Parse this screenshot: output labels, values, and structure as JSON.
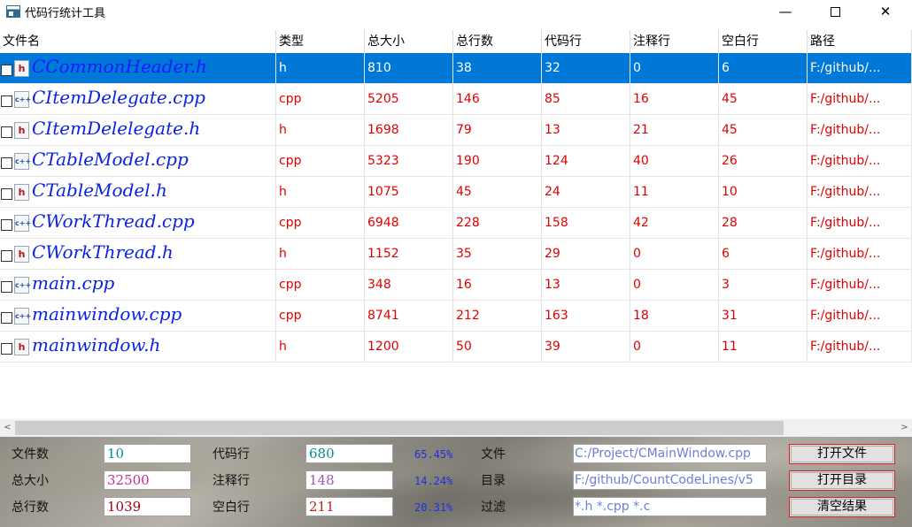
{
  "window": {
    "title": "代码行统计工具",
    "minimize_glyph": "—",
    "close_glyph": "✕"
  },
  "table": {
    "columns": [
      "文件名",
      "类型",
      "总大小",
      "总行数",
      "代码行",
      "注释行",
      "空白行",
      "路径"
    ],
    "rows": [
      {
        "name": "CCommonHeader.h",
        "type": "h",
        "size": "810",
        "total": "38",
        "code": "32",
        "comment": "0",
        "blank": "6",
        "path": "F:/github/...",
        "icon": "h-file-icon",
        "selected": true
      },
      {
        "name": "CItemDelegate.cpp",
        "type": "cpp",
        "size": "5205",
        "total": "146",
        "code": "85",
        "comment": "16",
        "blank": "45",
        "path": "F:/github/...",
        "icon": "cpp-file-icon",
        "selected": false
      },
      {
        "name": "CItemDelelegate.h",
        "type": "h",
        "size": "1698",
        "total": "79",
        "code": "13",
        "comment": "21",
        "blank": "45",
        "path": "F:/github/...",
        "icon": "h-file-icon",
        "selected": false
      },
      {
        "name": "CTableModel.cpp",
        "type": "cpp",
        "size": "5323",
        "total": "190",
        "code": "124",
        "comment": "40",
        "blank": "26",
        "path": "F:/github/...",
        "icon": "cpp-file-icon",
        "selected": false
      },
      {
        "name": "CTableModel.h",
        "type": "h",
        "size": "1075",
        "total": "45",
        "code": "24",
        "comment": "11",
        "blank": "10",
        "path": "F:/github/...",
        "icon": "h-file-icon",
        "selected": false
      },
      {
        "name": "CWorkThread.cpp",
        "type": "cpp",
        "size": "6948",
        "total": "228",
        "code": "158",
        "comment": "42",
        "blank": "28",
        "path": "F:/github/...",
        "icon": "cpp-file-icon",
        "selected": false
      },
      {
        "name": "CWorkThread.h",
        "type": "h",
        "size": "1152",
        "total": "35",
        "code": "29",
        "comment": "0",
        "blank": "6",
        "path": "F:/github/...",
        "icon": "h-file-icon",
        "selected": false
      },
      {
        "name": "main.cpp",
        "type": "cpp",
        "size": "348",
        "total": "16",
        "code": "13",
        "comment": "0",
        "blank": "3",
        "path": "F:/github/...",
        "icon": "cpp-file-icon",
        "selected": false
      },
      {
        "name": "mainwindow.cpp",
        "type": "cpp",
        "size": "8741",
        "total": "212",
        "code": "163",
        "comment": "18",
        "blank": "31",
        "path": "F:/github/...",
        "icon": "cpp-file-icon",
        "selected": false
      },
      {
        "name": "mainwindow.h",
        "type": "h",
        "size": "1200",
        "total": "50",
        "code": "39",
        "comment": "0",
        "blank": "11",
        "path": "F:/github/...",
        "icon": "h-file-icon",
        "selected": false
      }
    ]
  },
  "scrollbar": {
    "left_arrow": "<",
    "right_arrow": ">"
  },
  "stats": {
    "file_count_label": "文件数",
    "file_count": "10",
    "total_size_label": "总大小",
    "total_size": "32500",
    "total_lines_label": "总行数",
    "total_lines": "1039",
    "code_lines_label": "代码行",
    "code_lines": "680",
    "code_pct": "65.45%",
    "comment_lines_label": "注释行",
    "comment_lines": "148",
    "comment_pct": "14.24%",
    "blank_lines_label": "空白行",
    "blank_lines": "211",
    "blank_pct": "20.31%",
    "colors": {
      "file_count": "#009090",
      "total_size": "#c0308a",
      "total_lines": "#a00010",
      "code_lines": "#009090",
      "comment_lines": "#9c59b6",
      "blank_lines": "#c02020"
    }
  },
  "controls": {
    "file_label": "文件",
    "file_path": "C:/Project/CMainWindow.cpp",
    "dir_label": "目录",
    "dir_path": "F:/github/CountCodeLines/v5",
    "filter_label": "过滤",
    "filter_value": "*.h *.cpp *.c",
    "open_file_button": "打开文件",
    "open_dir_button": "打开目录",
    "clear_button": "清空结果"
  }
}
